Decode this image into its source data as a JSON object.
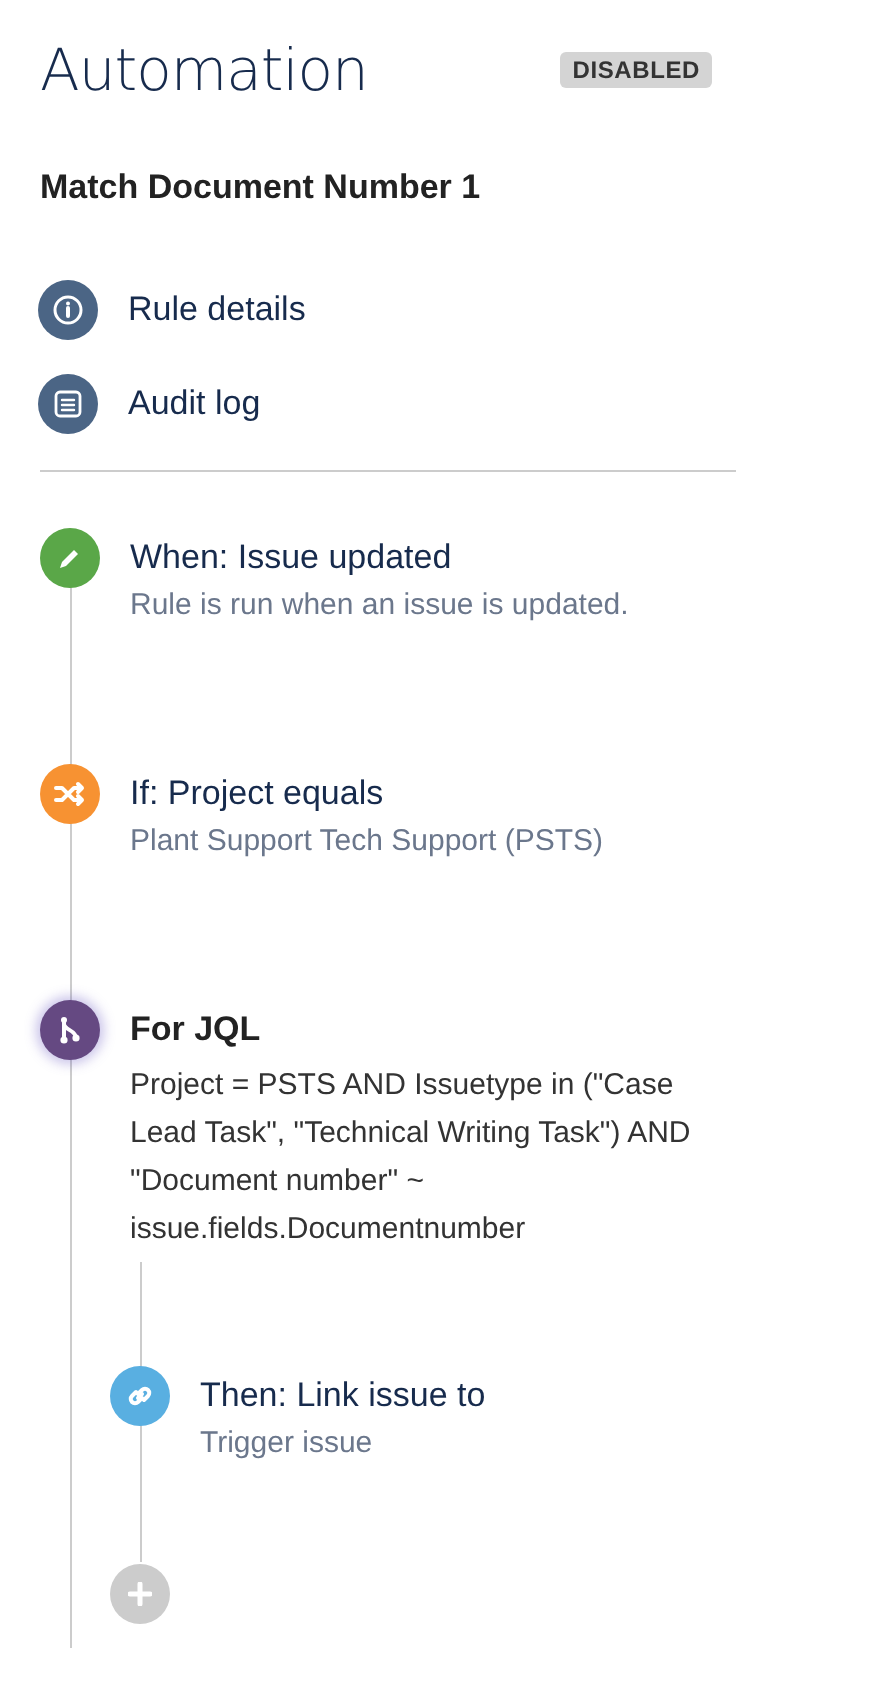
{
  "header": {
    "title": "Automation",
    "status_badge": "DISABLED"
  },
  "rule_name": "Match Document Number 1",
  "nav": [
    {
      "kind": "info",
      "label": "Rule details"
    },
    {
      "kind": "log",
      "label": "Audit log"
    }
  ],
  "steps": [
    {
      "kind": "trigger",
      "title": "When: Issue updated",
      "description": "Rule is run when an issue is updated.",
      "selected": false
    },
    {
      "kind": "condition",
      "title": "If: Project equals",
      "description": "Plant Support Tech Support (PSTS)",
      "selected": false
    },
    {
      "kind": "branch",
      "title": "For JQL",
      "description": "Project = PSTS AND Issuetype in (\"Case Lead Task\", \"Technical Writing Task\") AND \"Document number\" ~ issue.fields.Documentnumber",
      "selected": true,
      "children": [
        {
          "kind": "action",
          "title": "Then: Link issue to",
          "description": "Trigger issue",
          "selected": false
        }
      ]
    }
  ]
}
